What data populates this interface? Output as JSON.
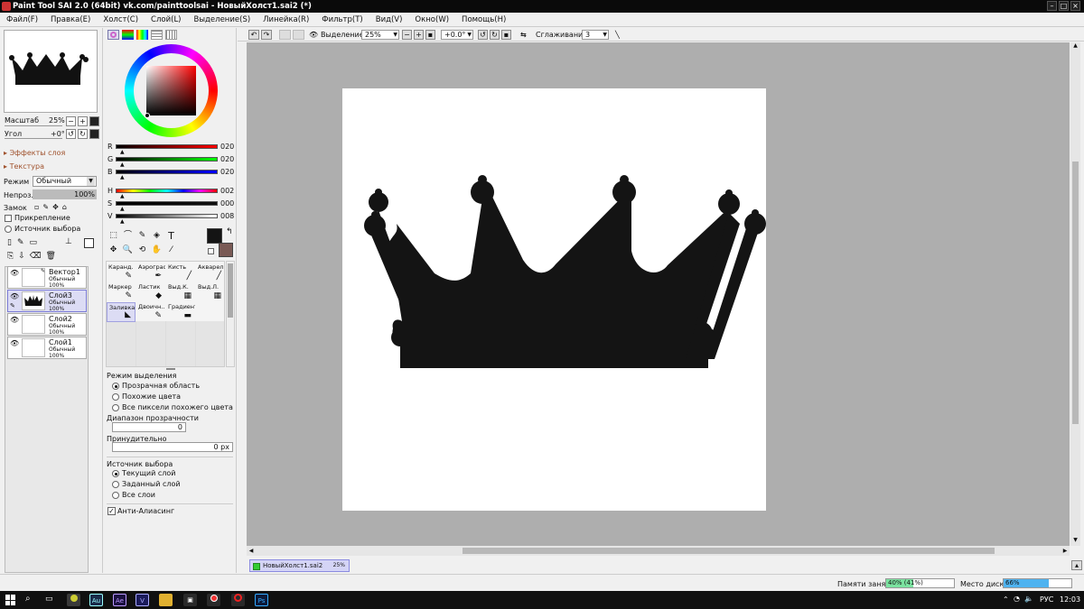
{
  "window": {
    "title": "Paint Tool SAI 2.0 (64bit) vk.com/painttoolsai - НовыйХолст1.sai2 (*)"
  },
  "menu": [
    "Файл(F)",
    "Правка(E)",
    "Холст(C)",
    "Слой(L)",
    "Выделение(S)",
    "Линейка(R)",
    "Фильтр(T)",
    "Вид(V)",
    "Окно(W)",
    "Помощь(H)"
  ],
  "navigator": {
    "zoom_label": "Масштаб",
    "zoom_value": "25%",
    "angle_label": "Угол",
    "angle_value": "+0°"
  },
  "layer_panel": {
    "effects_label": "Эффекты слоя",
    "texture_label": "Текстура",
    "mode_label": "Режим",
    "mode_value": "Обычный",
    "opacity_label": "Непроз.",
    "opacity_value": "100%",
    "lock_label": "Замок",
    "clip_label": "Прикрепление",
    "source_label": "Источник выбора",
    "layers": [
      {
        "name": "Вектор1",
        "mode": "Обычный",
        "opacity": "100%"
      },
      {
        "name": "Слой3",
        "mode": "Обычный",
        "opacity": "100%"
      },
      {
        "name": "Слой2",
        "mode": "Обычный",
        "opacity": "100%"
      },
      {
        "name": "Слой1",
        "mode": "Обычный",
        "opacity": "100%"
      }
    ]
  },
  "color_panel": {
    "r_label": "R",
    "r_value": "020",
    "g_label": "G",
    "g_value": "020",
    "b_label": "B",
    "b_value": "020",
    "h_label": "H",
    "h_value": "002",
    "s_label": "S",
    "s_value": "000",
    "v_label": "V",
    "v_value": "008",
    "primary_color": "#141414",
    "secondary_color": "#7a5a55"
  },
  "tools": {
    "select_tools": [
      "⬚",
      "⌒",
      "✎",
      "◈",
      "T",
      "✥",
      "🔍",
      "⟲",
      "✋",
      "⁄"
    ],
    "brushes": [
      {
        "name": "Каранд."
      },
      {
        "name": "Аэрограф"
      },
      {
        "name": "Кисть"
      },
      {
        "name": "Акварель"
      },
      {
        "name": "Маркер"
      },
      {
        "name": "Ластик"
      },
      {
        "name": "Выд.К."
      },
      {
        "name": "Выд.Л."
      },
      {
        "name": "Заливка"
      },
      {
        "name": "Двоичн..."
      },
      {
        "name": "Градиент"
      }
    ]
  },
  "tool_options": {
    "selection_mode_label": "Режим выделения",
    "options_mode": [
      "Прозрачная область",
      "Похожие цвета",
      "Все пиксели похожего цвета"
    ],
    "tolerance_label": "Диапазон прозрачности",
    "tolerance_value": "0",
    "force_label": "Принудительно",
    "force_value": "0 px",
    "source_label": "Источник выбора",
    "options_source": [
      "Текущий слой",
      "Заданный слой",
      "Все слои"
    ],
    "antialias_label": "Анти-Алиасинг"
  },
  "toolbar": {
    "selection_label": "Выделение",
    "zoom_value": "25%",
    "angle_value": "+0.0°",
    "smoothing_label": "Сглаживание",
    "smoothing_value": "3"
  },
  "document_tab": {
    "name": "НовыйХолст1.sai2",
    "zoom": "25%"
  },
  "status": {
    "memory_label": "Памяти занято",
    "memory_value": "40% (41%)",
    "memory_fraction": 0.4,
    "disk_label": "Место диска",
    "disk_value": "66%",
    "disk_fraction": 0.66
  },
  "taskbar": {
    "lang": "РУС",
    "time": "12:03",
    "apps": [
      "Au",
      "Ae",
      "V",
      "Ps"
    ]
  }
}
